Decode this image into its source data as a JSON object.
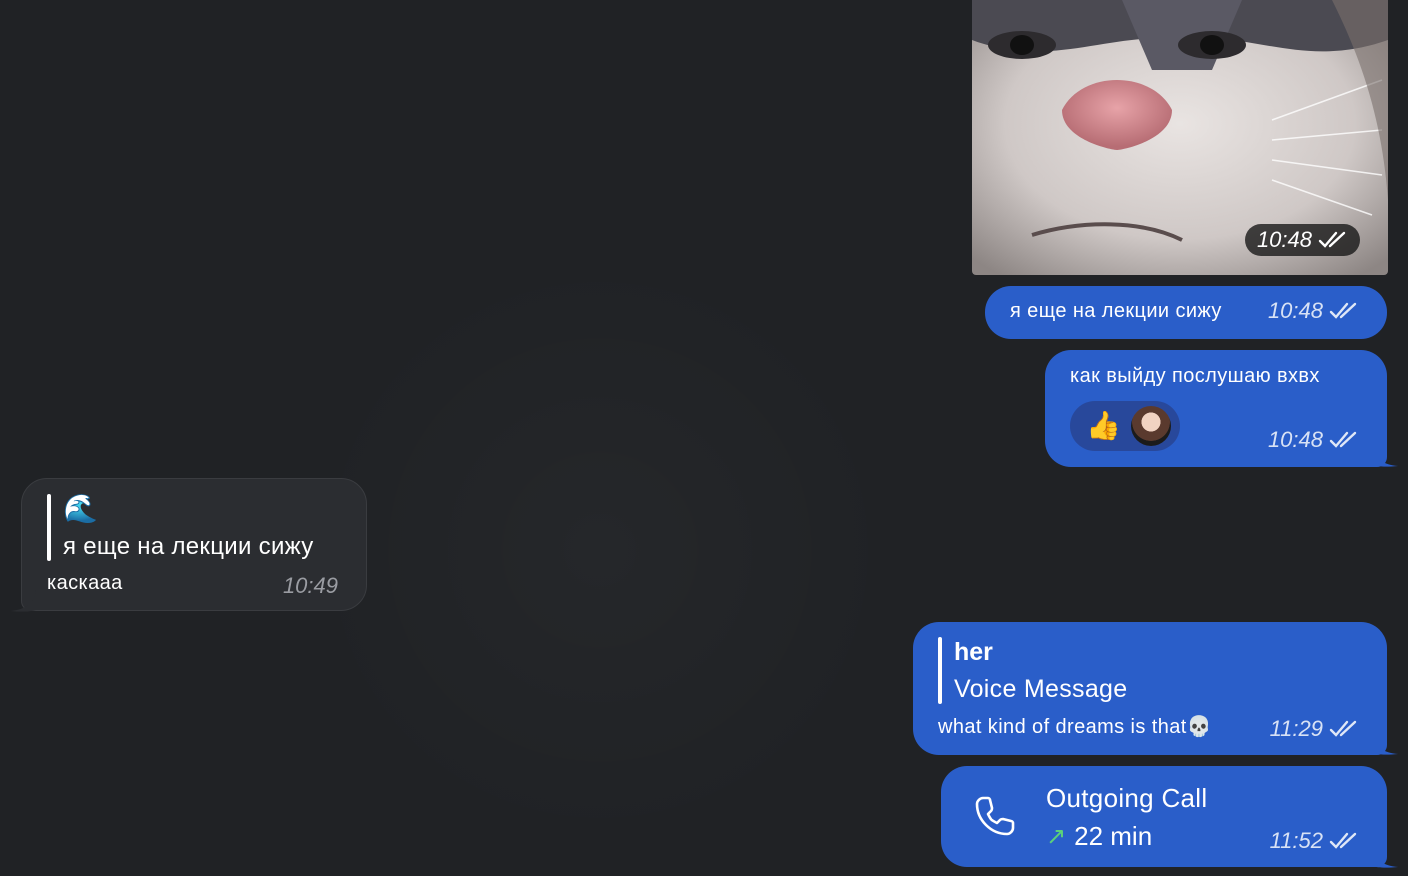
{
  "messages": {
    "photo": {
      "time": "10:48"
    },
    "out1": {
      "text": "я еще на лекции сижу",
      "time": "10:48"
    },
    "out2": {
      "text": "как выйду послушаю вхвх",
      "reaction": "👍",
      "time": "10:48"
    },
    "in1": {
      "quote_emoji": "🌊",
      "quote_text": "я еще на лекции сижу",
      "text": "каскааа",
      "time": "10:49"
    },
    "out3": {
      "quote_author": "her",
      "quote_text": "Voice Message",
      "text": "what kind of dreams is that💀",
      "time": "11:29"
    },
    "call": {
      "title": "Outgoing Call",
      "duration": "22 min",
      "time": "11:52"
    }
  },
  "colors": {
    "background": "#202225",
    "outgoing": "#2a5ec9",
    "incoming": "#2b2d31",
    "call_arrow": "#5cd17a"
  }
}
